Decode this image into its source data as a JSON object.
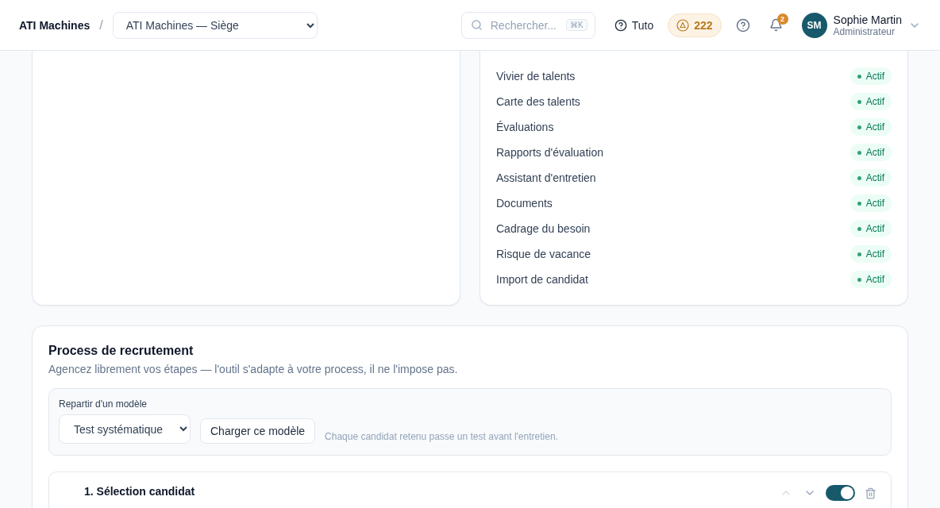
{
  "header": {
    "brand": "ATI Machines",
    "separator": "/",
    "site_select": "ATI Machines — Siège",
    "search": {
      "placeholder": "Rechercher...",
      "shortcut": "⌘K"
    },
    "tuto": "Tuto",
    "credits": "222",
    "notifications": "2",
    "user": {
      "initials": "SM",
      "name": "Sophie Martin",
      "role": "Administrateur"
    }
  },
  "modules": [
    {
      "name": "Vivier de talents",
      "status": "Actif",
      "active": true
    },
    {
      "name": "Carte des talents",
      "status": "Actif",
      "active": true
    },
    {
      "name": "Évaluations",
      "status": "Actif",
      "active": true
    },
    {
      "name": "Rapports d'évaluation",
      "status": "Actif",
      "active": true
    },
    {
      "name": "Assistant d'entretien",
      "status": "Actif",
      "active": true
    },
    {
      "name": "Documents",
      "status": "Actif",
      "active": true
    },
    {
      "name": "Cadrage du besoin",
      "status": "Actif",
      "active": true
    },
    {
      "name": "Risque de vacance",
      "status": "Actif",
      "active": true
    },
    {
      "name": "Import de candidat",
      "status": "Actif",
      "active": true
    }
  ],
  "process": {
    "title": "Process de recrutement",
    "subtitle": "Agencez librement vos étapes — l'outil s'adapte à votre process, il ne l'impose pas.",
    "template": {
      "label": "Repartir d'un modèle",
      "select": "Test systématique",
      "button": "Charger ce modèle",
      "hint": "Chaque candidat retenu passe un test avant l'entretien."
    },
    "steps": [
      {
        "title": "1. Sélection candidat",
        "enabled": true,
        "up_disabled": true,
        "down_disabled": false
      }
    ]
  }
}
